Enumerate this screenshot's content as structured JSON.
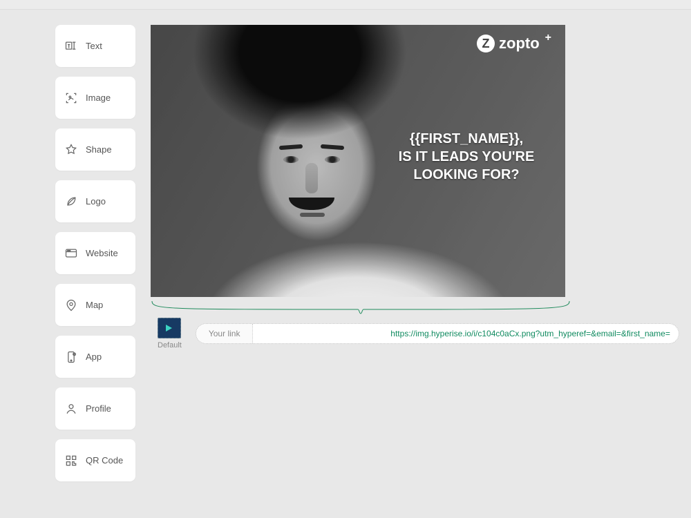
{
  "sidebar": {
    "items": [
      {
        "label": "Text",
        "icon": "text-icon"
      },
      {
        "label": "Image",
        "icon": "image-scan-icon"
      },
      {
        "label": "Shape",
        "icon": "star-icon"
      },
      {
        "label": "Logo",
        "icon": "leaf-icon"
      },
      {
        "label": "Website",
        "icon": "webpage-icon"
      },
      {
        "label": "Map",
        "icon": "map-pin-icon"
      },
      {
        "label": "App",
        "icon": "phone-app-icon"
      },
      {
        "label": "Profile",
        "icon": "profile-icon"
      },
      {
        "label": "QR Code",
        "icon": "qrcode-icon"
      }
    ]
  },
  "canvas": {
    "brand_name": "zopto",
    "overlay_line1": "{{FIRST_NAME}},",
    "overlay_line2": "IS IT LEADS YOU'RE",
    "overlay_line3": "LOOKING FOR?"
  },
  "output": {
    "default_label": "Default",
    "link_lead": "Your link",
    "link_url": "https://img.hyperise.io/i/c104c0aCx.png?utm_hyperef=&email=&first_name="
  }
}
